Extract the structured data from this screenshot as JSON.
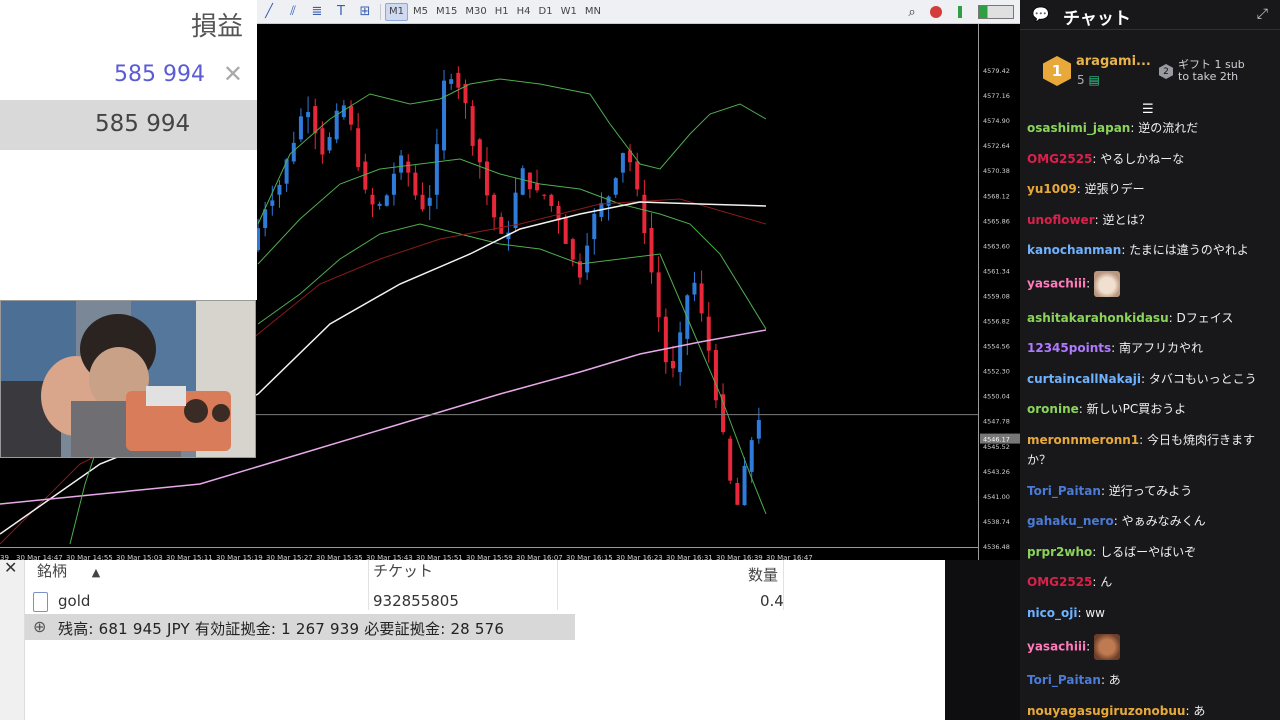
{
  "profit_panel": {
    "header": "損益",
    "value_top": "585 994",
    "value_row": "585 994"
  },
  "toolbar": {
    "timeframes": [
      "M1",
      "M5",
      "M15",
      "M30",
      "H1",
      "H4",
      "D1",
      "W1",
      "MN"
    ],
    "active_timeframe": "M1"
  },
  "chart": {
    "price_ticks": [
      "4579.42",
      "4577.16",
      "4574.90",
      "4572.64",
      "4570.38",
      "4568.12",
      "4565.86",
      "4563.60",
      "4561.34",
      "4559.08",
      "4556.82",
      "4554.56",
      "4552.30",
      "4550.04",
      "4547.78",
      "4545.52",
      "4543.26",
      "4541.00",
      "4538.74",
      "4536.48"
    ],
    "current_price_label": "4546.17",
    "time_ticks": [
      "30 Mar 14:47",
      "30 Mar 14:55",
      "30 Mar 15:03",
      "30 Mar 15:11",
      "30 Mar 15:19",
      "30 Mar 15:27",
      "30 Mar 15:35",
      "30 Mar 15:43",
      "30 Mar 15:51",
      "30 Mar 15:59",
      "30 Mar 16:07",
      "30 Mar 16:15",
      "30 Mar 16:23",
      "30 Mar 16:31",
      "30 Mar 16:39",
      "30 Mar 16:47"
    ],
    "first_tick_partial": "39"
  },
  "terminal": {
    "columns": {
      "symbol": "銘柄",
      "ticket": "チケット",
      "volume": "数量"
    },
    "rows": [
      {
        "symbol": "gold",
        "ticket": "932855805",
        "volume": "0.4"
      }
    ],
    "balance_text": "残高: 681 945 JPY  有効証拠金: 1 267 939  必要証拠金: 28 576"
  },
  "chat": {
    "title": "チャット",
    "hype": {
      "rank": "1",
      "user": "aragami...",
      "count": "5",
      "rank2": "2",
      "gift_line1": "ギフト 1 sub",
      "gift_line2": "to take 2th"
    },
    "messages": [
      {
        "user": "osashimi_japan",
        "color": "#8bd45a",
        "text": "逆の流れだ"
      },
      {
        "user": "OMG2525",
        "color": "#d9214b",
        "text": "やるしかねーな"
      },
      {
        "user": "yu1009",
        "color": "#e8a93a",
        "text": "逆張りデー"
      },
      {
        "user": "unoflower",
        "color": "#d9214b",
        "text": "逆とは？"
      },
      {
        "user": "kanochanman",
        "color": "#6fb2ff",
        "text": "たまには違うのやれよ"
      },
      {
        "user": "yasachiii",
        "color": "#ff7ab8",
        "text": "",
        "emote": "cat-emote"
      },
      {
        "user": "ashitakarahonkidasu",
        "color": "#8bd45a",
        "text": "Dフェイス"
      },
      {
        "user": "12345points",
        "color": "#b07aff",
        "text": "南アフリカやれ"
      },
      {
        "user": "curtaincallNakaji",
        "color": "#6fb2ff",
        "text": "タバコもいっとこう"
      },
      {
        "user": "oronine",
        "color": "#8bd45a",
        "text": "新しいPC買おうよ"
      },
      {
        "user": "meronnmeronn1",
        "color": "#e8a93a",
        "text": "今日も焼肉行きますか？"
      },
      {
        "user": "Tori_Paitan",
        "color": "#4b7bd6",
        "text": "逆行ってみよう"
      },
      {
        "user": "gahaku_nero",
        "color": "#4b7bd6",
        "text": "やぁみなみくん"
      },
      {
        "user": "prpr2who",
        "color": "#8bd45a",
        "text": "しるばーやばいぞ"
      },
      {
        "user": "OMG2525",
        "color": "#d9214b",
        "text": "ん"
      },
      {
        "user": "nico_oji",
        "color": "#6fb2ff",
        "text": "ww"
      },
      {
        "user": "yasachiii",
        "color": "#ff7ab8",
        "text": "",
        "emote": "face-emote"
      },
      {
        "user": "Tori_Paitan",
        "color": "#4b7bd6",
        "text": "あ"
      },
      {
        "user": "nouyagasugiruzonobuu",
        "color": "#e8a93a",
        "text": "あ"
      }
    ]
  }
}
